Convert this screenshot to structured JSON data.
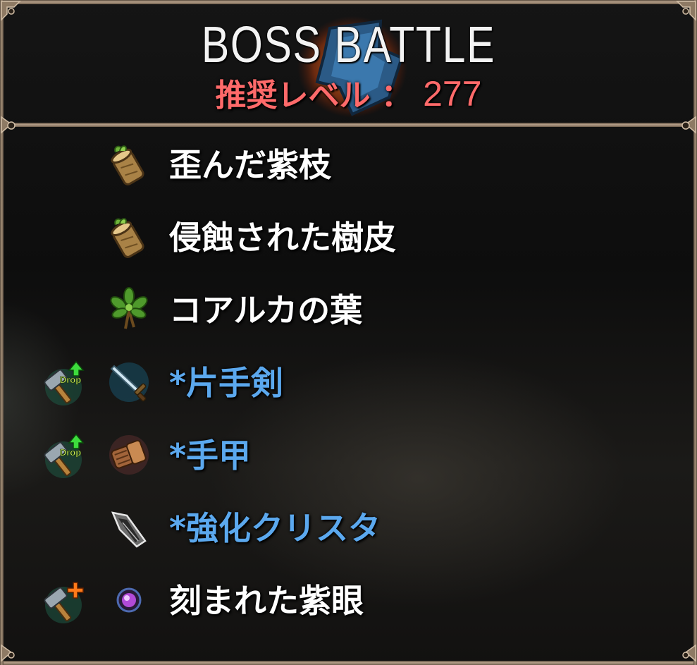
{
  "header": {
    "title": "BOSS BATTLE",
    "level_label": "推奨レベル",
    "level_separator": "：",
    "level_value": "277"
  },
  "colors": {
    "level_text": "#ff6a6a",
    "name_default": "#ffffff",
    "name_highlight": "#5ba8ee",
    "frame": "#a48f78"
  },
  "items": [
    {
      "name": "歪んだ紫枝",
      "icon": "wood-log-sprout-icon",
      "badge": null,
      "highlight": false
    },
    {
      "name": "侵蝕された樹皮",
      "icon": "wood-log-sprout-icon",
      "badge": null,
      "highlight": false
    },
    {
      "name": "コアルカの葉",
      "icon": "leaf-plant-icon",
      "badge": null,
      "highlight": false
    },
    {
      "name": "*片手剣",
      "icon": "sword-icon",
      "badge": {
        "icon": "hammer-drop-up-icon",
        "label": "Drop"
      },
      "highlight": true
    },
    {
      "name": "*手甲",
      "icon": "gauntlet-icon",
      "badge": {
        "icon": "hammer-drop-up-icon",
        "label": "Drop"
      },
      "highlight": true
    },
    {
      "name": "*強化クリスタ",
      "icon": "crystal-shard-icon",
      "badge": null,
      "highlight": true
    },
    {
      "name": "刻まれた紫眼",
      "icon": "purple-orb-icon",
      "badge": {
        "icon": "hammer-plus-icon",
        "label": ""
      },
      "highlight": false
    }
  ]
}
